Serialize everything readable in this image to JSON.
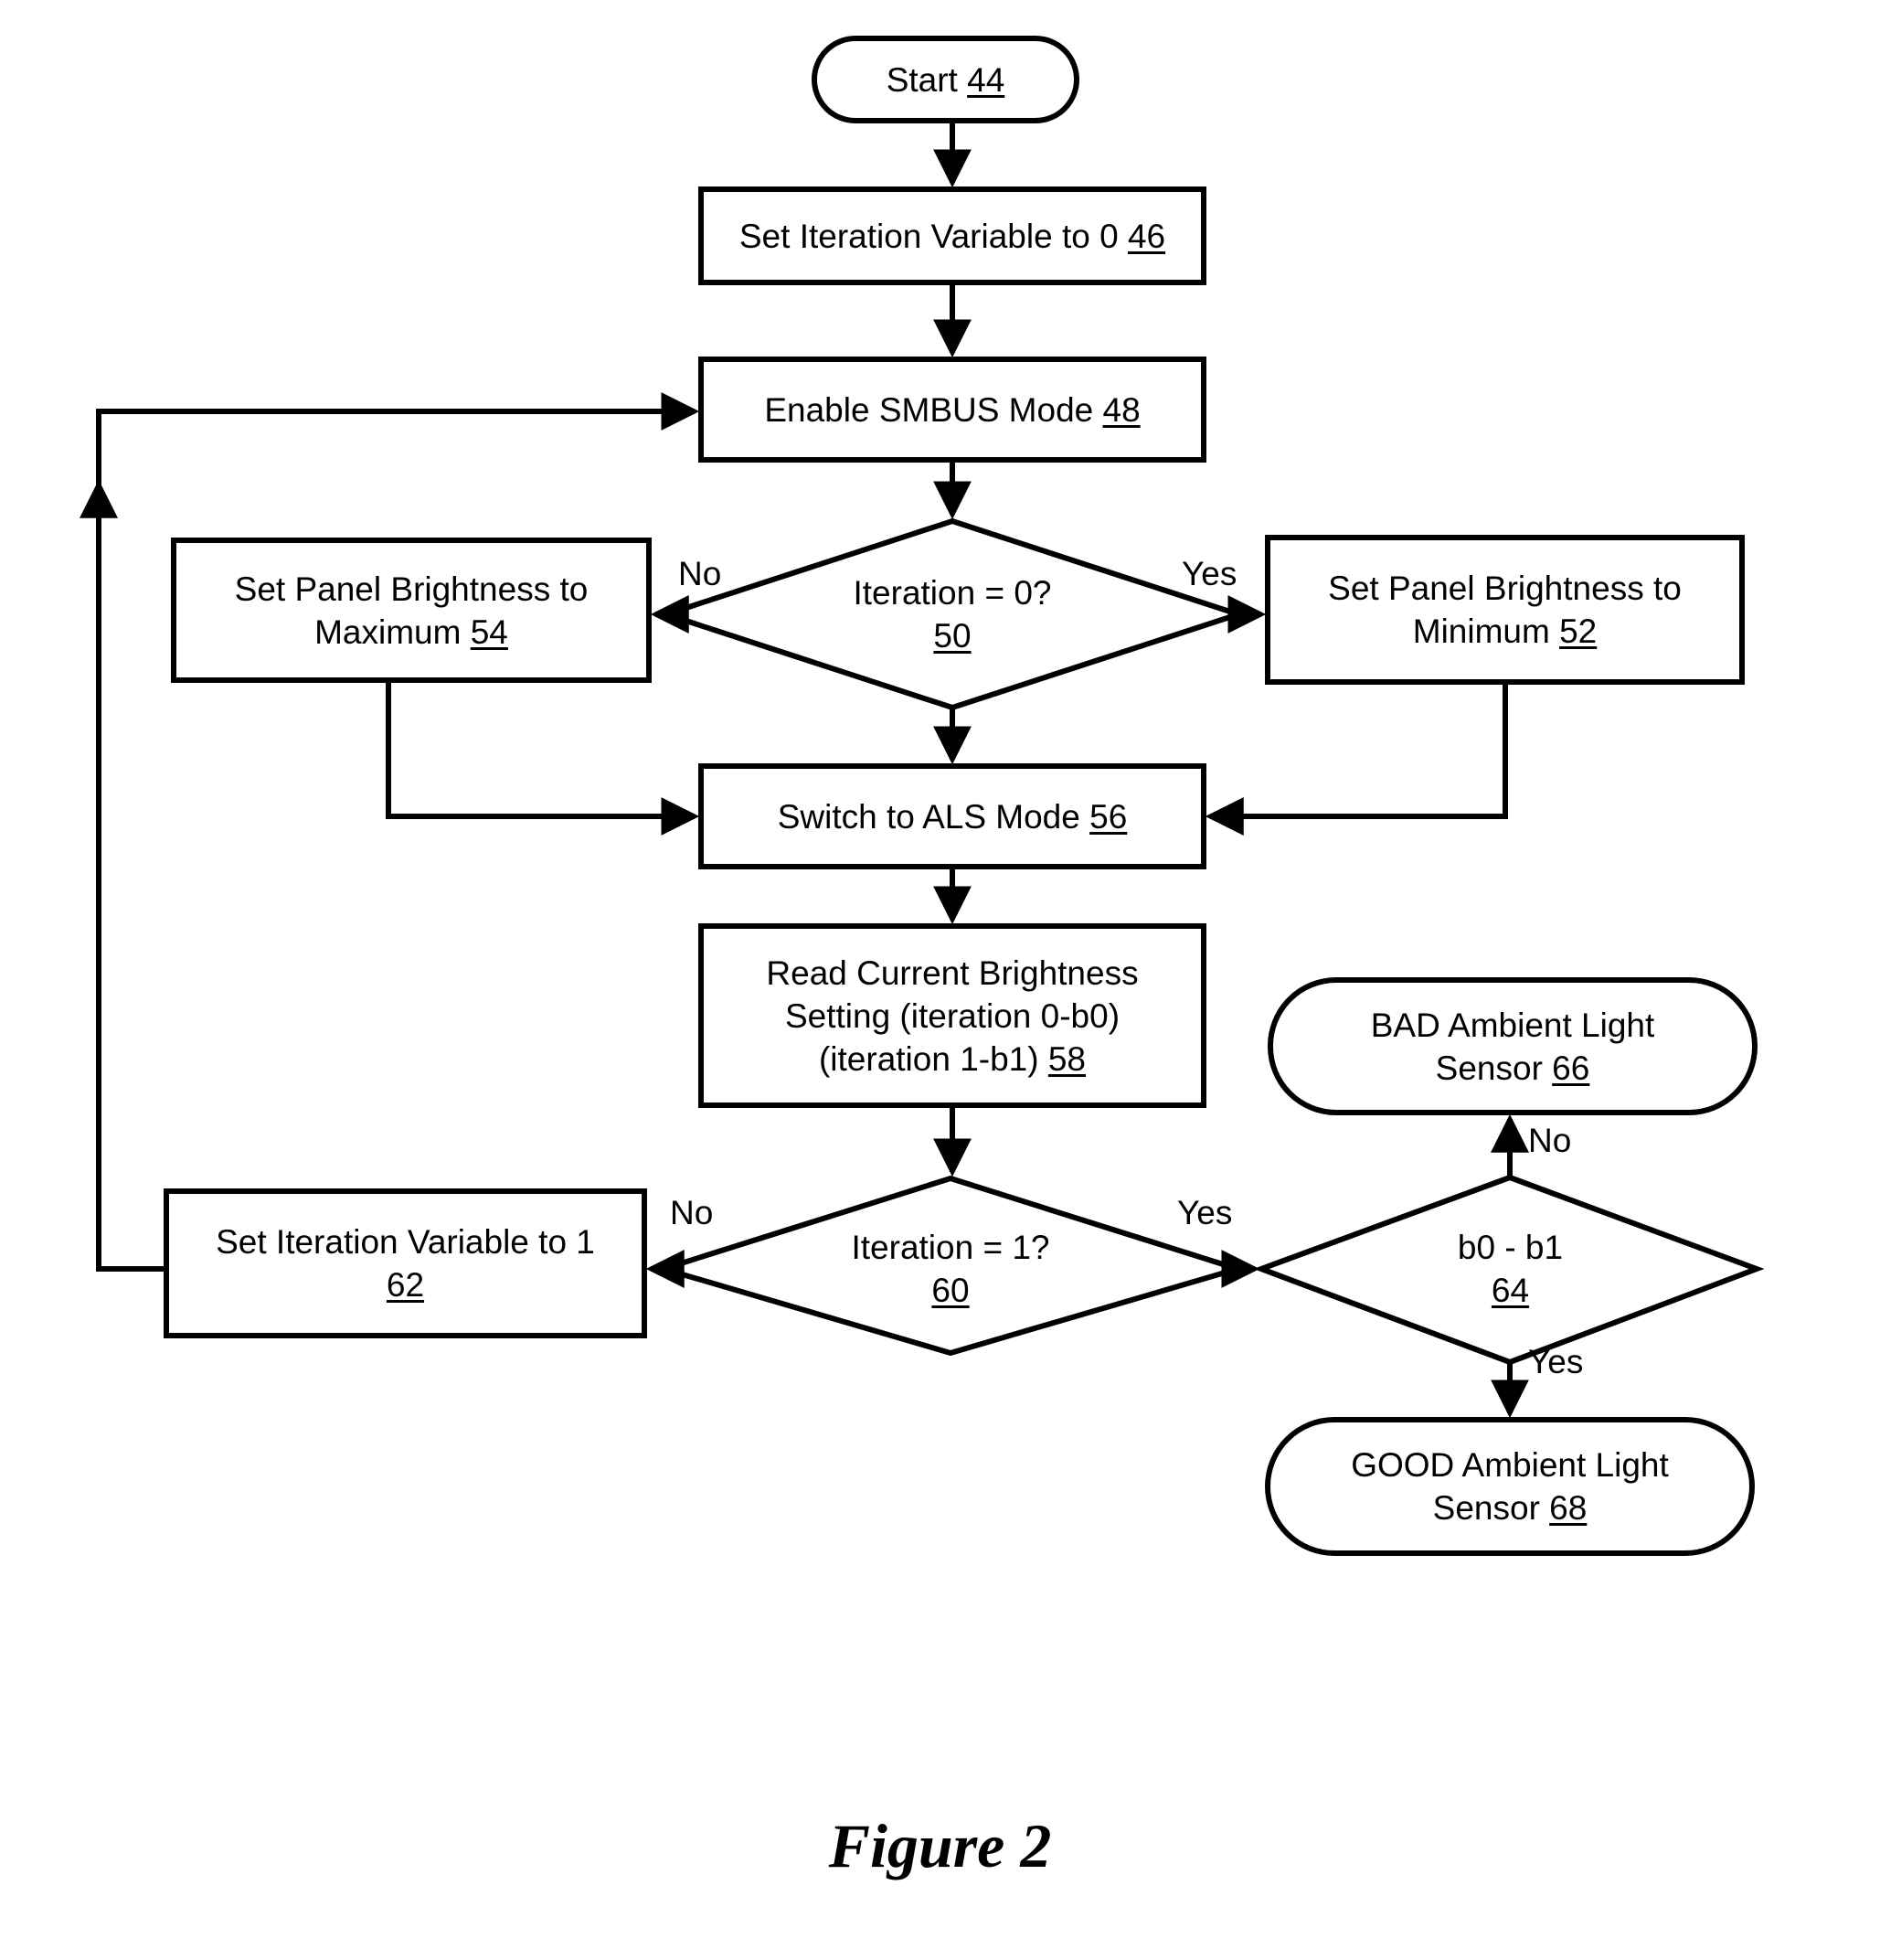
{
  "figure": {
    "caption": "Figure 2"
  },
  "diagram": {
    "type": "flowchart",
    "nodes": [
      {
        "id": "start",
        "shape": "terminator",
        "label": "Start",
        "ref": "44",
        "text": "Start 44"
      },
      {
        "id": "set_iter_0",
        "shape": "process",
        "label": "Set Iteration Variable to 0",
        "ref": "46",
        "text": "Set Iteration Variable to 0 46"
      },
      {
        "id": "enable_smbus",
        "shape": "process",
        "label": "Enable SMBUS Mode",
        "ref": "48",
        "text": "Enable SMBUS Mode 48"
      },
      {
        "id": "iter_is_0",
        "shape": "decision",
        "label": "Iteration = 0?",
        "ref": "50",
        "text": "Iteration = 0?"
      },
      {
        "id": "bright_min",
        "shape": "process",
        "label": "Set Panel Brightness to Minimum",
        "ref": "52",
        "line1": "Set Panel Brightness to",
        "line2": "Minimum",
        "text": "Set Panel Brightness to Minimum 52"
      },
      {
        "id": "bright_max",
        "shape": "process",
        "label": "Set Panel Brightness to Maximum",
        "ref": "54",
        "line1": "Set Panel Brightness to",
        "line2": "Maximum",
        "text": "Set Panel Brightness to Maximum 54"
      },
      {
        "id": "als_mode",
        "shape": "process",
        "label": "Switch to ALS Mode",
        "ref": "56",
        "text": "Switch to ALS Mode 56"
      },
      {
        "id": "read_bright",
        "shape": "process",
        "label": "Read Current Brightness Setting (iteration 0-b0) (iteration 1-b1)",
        "ref": "58",
        "line1": "Read Current Brightness",
        "line2": "Setting (iteration 0-b0)",
        "line3": "(iteration 1-b1)",
        "text": "Read Current Brightness Setting (iteration 0-b0) (iteration 1-b1) 58"
      },
      {
        "id": "iter_is_1",
        "shape": "decision",
        "label": "Iteration = 1?",
        "ref": "60",
        "text": "Iteration = 1?"
      },
      {
        "id": "set_iter_1",
        "shape": "process",
        "label": "Set Iteration Variable to 1",
        "ref": "62",
        "text": "Set Iteration Variable to 1 62"
      },
      {
        "id": "b0_minus_b1",
        "shape": "decision",
        "label": "b0 - b1",
        "ref": "64",
        "text": "b0 - b1"
      },
      {
        "id": "bad_sensor",
        "shape": "terminator",
        "label": "BAD Ambient Light Sensor",
        "ref": "66",
        "line1": "BAD Ambient Light",
        "line2": "Sensor",
        "text": "BAD Ambient Light Sensor 66"
      },
      {
        "id": "good_sensor",
        "shape": "terminator",
        "label": "GOOD Ambient Light Sensor",
        "ref": "68",
        "line1": "GOOD Ambient Light",
        "line2": "Sensor",
        "text": "GOOD Ambient Light Sensor 68"
      }
    ],
    "edge_labels": {
      "iter0_no": "No",
      "iter0_yes": "Yes",
      "iter1_no": "No",
      "iter1_yes": "Yes",
      "diff_no": "No",
      "diff_yes": "Yes"
    },
    "edges": [
      {
        "from": "start",
        "to": "set_iter_0",
        "label": ""
      },
      {
        "from": "set_iter_0",
        "to": "enable_smbus",
        "label": ""
      },
      {
        "from": "enable_smbus",
        "to": "iter_is_0",
        "label": ""
      },
      {
        "from": "iter_is_0",
        "to": "bright_max",
        "label": "No"
      },
      {
        "from": "iter_is_0",
        "to": "bright_min",
        "label": "Yes"
      },
      {
        "from": "iter_is_0",
        "to": "als_mode",
        "label": ""
      },
      {
        "from": "bright_max",
        "to": "als_mode",
        "label": ""
      },
      {
        "from": "bright_min",
        "to": "als_mode",
        "label": ""
      },
      {
        "from": "als_mode",
        "to": "read_bright",
        "label": ""
      },
      {
        "from": "read_bright",
        "to": "iter_is_1",
        "label": ""
      },
      {
        "from": "iter_is_1",
        "to": "set_iter_1",
        "label": "No"
      },
      {
        "from": "iter_is_1",
        "to": "b0_minus_b1",
        "label": "Yes"
      },
      {
        "from": "set_iter_1",
        "to": "enable_smbus",
        "label": ""
      },
      {
        "from": "b0_minus_b1",
        "to": "bad_sensor",
        "label": "No"
      },
      {
        "from": "b0_minus_b1",
        "to": "good_sensor",
        "label": "Yes"
      }
    ]
  },
  "colors": {
    "stroke": "#000000",
    "background": "#ffffff",
    "text": "#000000"
  }
}
